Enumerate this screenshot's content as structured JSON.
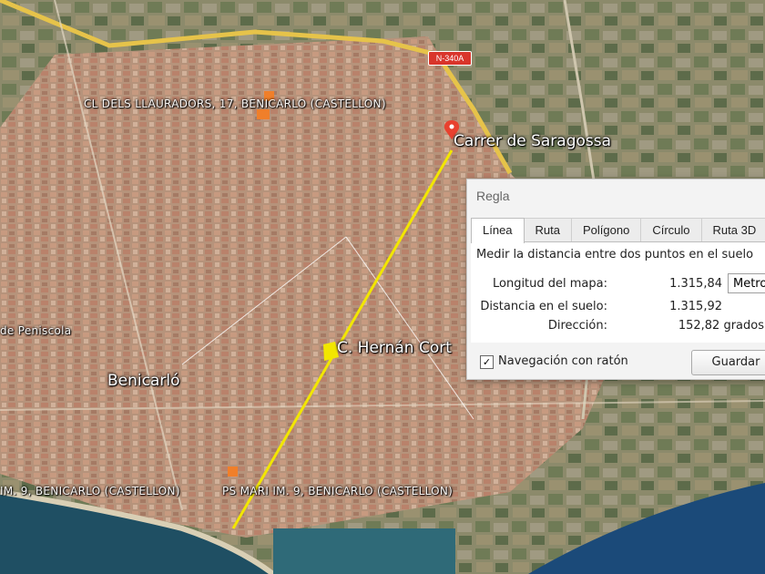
{
  "map": {
    "labels": {
      "llauradors": "CL DELS LLAURADORS, 17, BENICARLO (CASTELLON)",
      "saragossa": "Carrer de Saragossa",
      "hernan": "C. Hernán Cort",
      "peniscola": "de Peniscola",
      "benicarlo": "Benicarló",
      "bottom_left": "IM. 9, BENICARLO (CASTELLON)",
      "bottom_right": "PS MARI IM. 9, BENICARLO (CASTELLON)"
    },
    "road_shield": "N-340A",
    "colors": {
      "measure_line": "#f2e600",
      "marker": "#e8412f",
      "placemark": "#f07f2a"
    }
  },
  "dialog": {
    "title": "Regla",
    "tabs": [
      "Línea",
      "Ruta",
      "Polígono",
      "Círculo",
      "Ruta 3D"
    ],
    "active_tab": "Línea",
    "description": "Medir la distancia entre dos puntos en el suelo",
    "map_length_label": "Longitud del mapa:",
    "map_length_value": "1.315,84",
    "unit": "Metros",
    "ground_distance_label": "Distancia en el suelo:",
    "ground_distance_value": "1.315,92",
    "direction_label": "Dirección:",
    "direction_value": "152,82 grados",
    "mouse_nav_check": "✓",
    "mouse_nav_label": "Navegación con ratón",
    "save_label": "Guardar"
  }
}
